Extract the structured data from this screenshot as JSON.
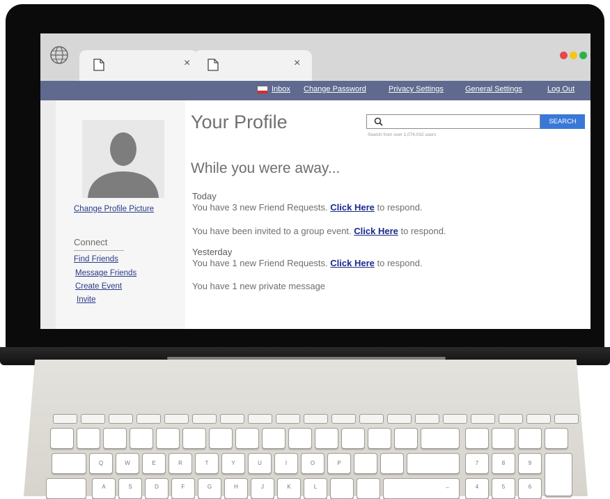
{
  "browser": {
    "tabs": [
      {
        "close_glyph": "×"
      },
      {
        "close_glyph": "×"
      }
    ],
    "window_dots": [
      "#e5484d",
      "#f5c518",
      "#2bb24c"
    ]
  },
  "nav": {
    "inbox": "Inbox",
    "change_password": "Change Password",
    "privacy_settings": "Privacy Settings",
    "general_settings": "General Settings",
    "log_out": "Log Out"
  },
  "sidebar": {
    "change_picture": "Change Profile Picture",
    "connect_heading": "Connect",
    "links": [
      "Find Friends",
      "Message Friends",
      "Create Event",
      "Invite"
    ]
  },
  "main": {
    "title": "Your Profile",
    "search": {
      "button": "SEARCH",
      "hint": "Search from over 1,074,032 users",
      "value": ""
    },
    "away_heading": "While you were away...",
    "today_label": "Today",
    "yesterday_label": "Yesterday",
    "notifications": [
      {
        "before": "You have 3 new Friend Requests.",
        "link": "Click Here",
        "after": "to respond."
      },
      {
        "before": "You have been invited to a group event.",
        "link": "Click Here",
        "after": "to respond."
      },
      {
        "before": "You have 1 new Friend Requests.",
        "link": "Click Here",
        "after": "to respond."
      },
      {
        "before": "You have 1 new private message",
        "link": "",
        "after": ""
      }
    ]
  },
  "keyboard": {
    "row_q": [
      "Q",
      "W",
      "E",
      "R",
      "T",
      "Y",
      "U",
      "I",
      "O",
      "P"
    ],
    "row_a": [
      "A",
      "S",
      "D",
      "F",
      "G",
      "H",
      "J",
      "K",
      "L"
    ],
    "numpad_top": [
      "7",
      "8",
      "9"
    ],
    "numpad_mid": [
      "4",
      "5",
      "6"
    ],
    "arrow_left": "←"
  },
  "colors": {
    "nav_bar": "#5f6a8e",
    "search_button": "#3a78d8",
    "link": "#1a2a8c"
  }
}
